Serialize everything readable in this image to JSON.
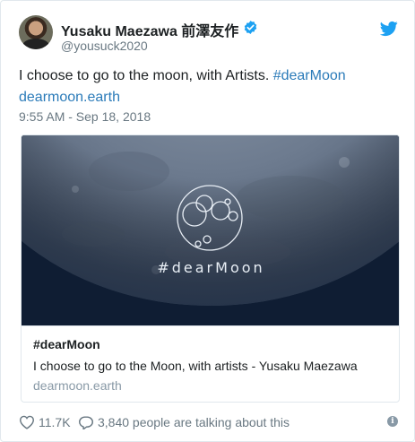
{
  "author": {
    "name": "Yusaku Maezawa 前澤友作",
    "handle": "@yousuck2020",
    "verified": true,
    "avatar_icon": "avatar"
  },
  "tweet": {
    "text_prefix": "I choose to go to the moon, with Artists. ",
    "hashtag": "#dearMoon",
    "link": "dearmoon.earth",
    "timestamp": "9:55 AM - Sep 18, 2018"
  },
  "card": {
    "image_text": "#dearMoon",
    "title": "#dearMoon",
    "description": "I choose to go to the Moon, with artists - Yusaku Maezawa",
    "domain": "dearmoon.earth"
  },
  "actions": {
    "likes": "11.7K",
    "replies_text": "3,840 people are talking about this"
  },
  "colors": {
    "link": "#2b7bb9",
    "muted": "#697882",
    "twitter_blue": "#1da1f2"
  },
  "icons": [
    "twitter-bird-icon",
    "verified-badge-icon",
    "heart-icon",
    "reply-icon",
    "info-icon"
  ]
}
